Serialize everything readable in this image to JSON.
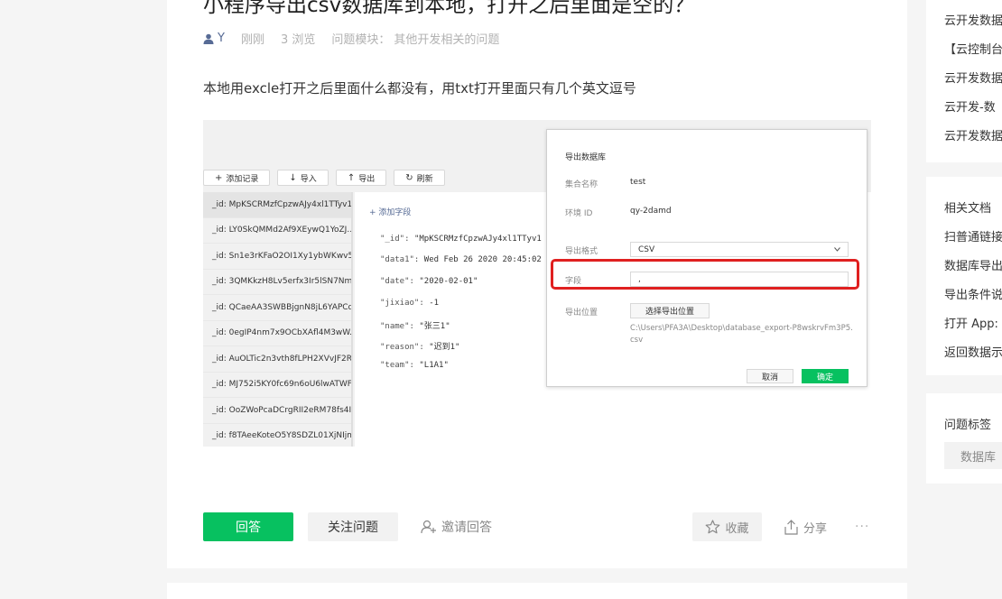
{
  "question": {
    "title": "小程序导出csv数据库到本地，打开之后里面是空的？",
    "author": "Y",
    "time": "刚刚",
    "views": "3 浏览",
    "module_label": "问题模块：",
    "module_value": "其他开发相关的问题",
    "description": "本地用excle打开之后里面什么都没有，用txt打开里面只有几个英文逗号"
  },
  "screenshot": {
    "toolbar": [
      {
        "icon": "+",
        "label": "添加记录"
      },
      {
        "icon": "↓",
        "label": "导入"
      },
      {
        "icon": "↑",
        "label": "导出"
      },
      {
        "icon": "↻",
        "label": "刷新"
      }
    ],
    "ids": [
      "_id: MpKSCRMzfCpzwAJy4xl1TTyv1...",
      "_id: LY0SkQMMd2Af9XEywQ1YoZJ...",
      "_id: Sn1e3rKFaO2OI1Xy1ybWKwv5...",
      "_id: 3QMKkzH8Lv5erfx3Ir5lSN7Nm...",
      "_id: QCaeAA3SWBBjgnN8jL6YAPCd...",
      "_id: 0egIP4nm7x9OCbXAfl4M3wW...",
      "_id: AuOLTic2n3vth8fLPH2XVvJF2R...",
      "_id: MJ752i5KY0fc69n6oU6lwATWF...",
      "_id: OoZWoPcaDCrgRII2eRM78fs4I...",
      "_id: f8TAeeKoteO5Y8SDZL01XjNIjm..."
    ],
    "add_field": "+ 添加字段",
    "fields": [
      {
        "key": "\"_id\":",
        "value": "\"MpKSCRMzfCpzwAJy4xl1TTyv1"
      },
      {
        "key": "\"data1\":",
        "value": "Wed Feb 26 2020 20:45:02"
      },
      {
        "key": "\"date\":",
        "value": "\"2020-02-01\""
      },
      {
        "key": "\"jixiao\":",
        "value": "-1"
      },
      {
        "key": "\"name\":",
        "value": "\"张三1\""
      },
      {
        "key": "\"reason\":",
        "value": "\"迟到1\""
      },
      {
        "key": "\"team\":",
        "value": "\"L1A1\""
      }
    ],
    "dialog": {
      "title": "导出数据库",
      "collection_label": "集合名称",
      "collection_value": "test",
      "env_label": "环境 ID",
      "env_value": "qy-2damd",
      "format_label": "导出格式",
      "format_value": "CSV",
      "field_label": "字段",
      "field_value": ",",
      "location_label": "导出位置",
      "choose_button": "选择导出位置",
      "path": "C:\\Users\\PFA3A\\Desktop\\database_export-P8wskrvFm3P5.csv",
      "cancel": "取消",
      "ok": "确定"
    }
  },
  "actions": {
    "answer": "回答",
    "follow": "关注问题",
    "invite": "邀请回答",
    "collect": "收藏",
    "share": "分享",
    "more": "···"
  },
  "sidebar": {
    "group1": [
      "云开发数据",
      "【云控制台",
      "云开发数据",
      "云开发-数",
      "云开发数据"
    ],
    "group2": [
      "相关文档",
      "扫普通链接",
      "数据库导出",
      "导出条件说",
      "打开 App:",
      "返回数据示"
    ],
    "tags_title": "问题标签",
    "tag": "数据库"
  },
  "colors": {
    "accent": "#07c160",
    "link": "#576b95",
    "highlight": "#e02020"
  }
}
